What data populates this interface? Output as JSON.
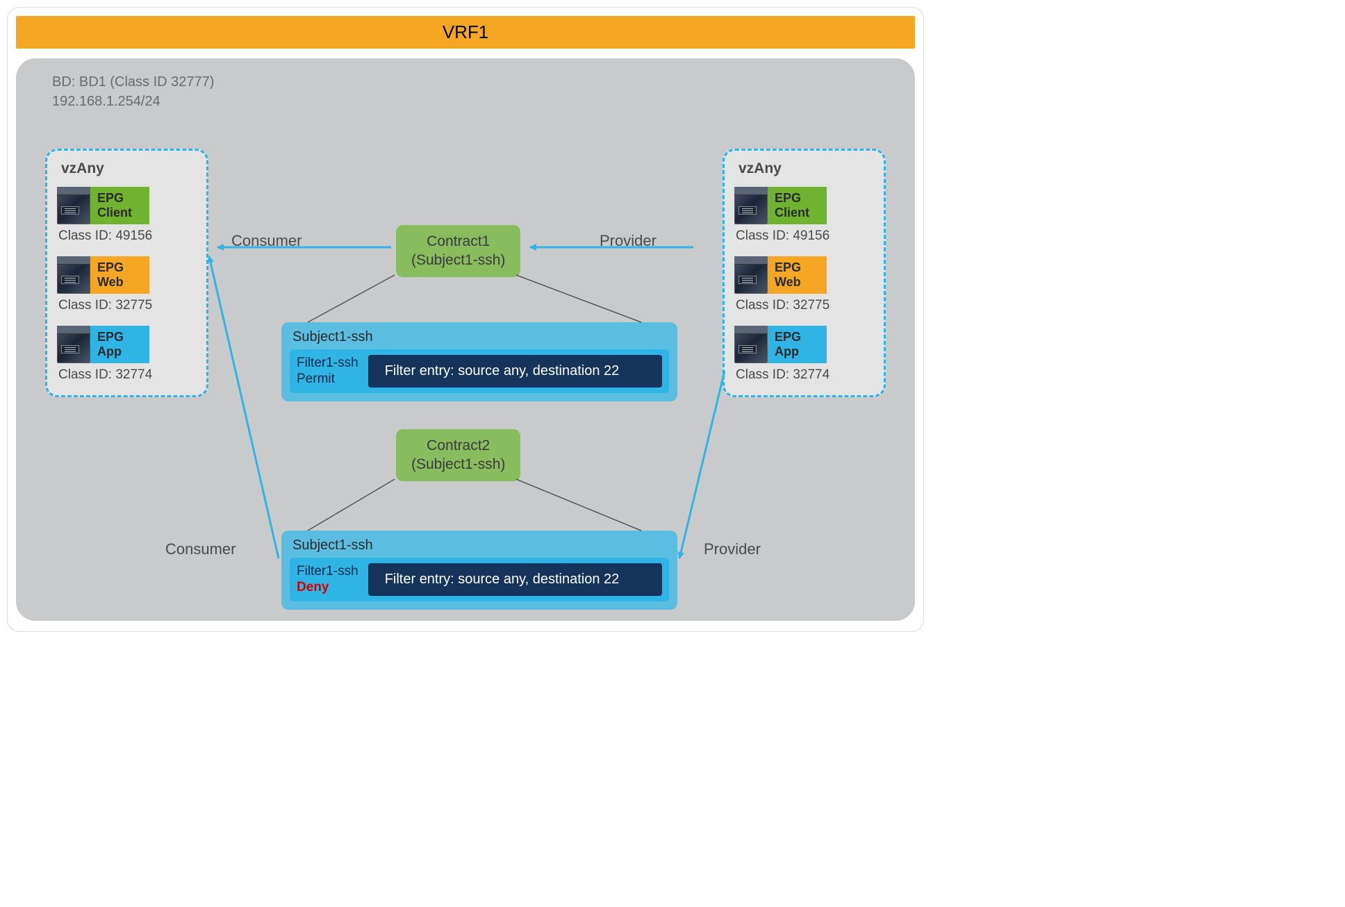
{
  "title": "VRF1",
  "bd": {
    "header_line1": "BD: BD1 (Class ID 32777)",
    "header_line2": "192.168.1.254/24"
  },
  "vzany": {
    "title": "vzAny",
    "epgs": [
      {
        "line1": "EPG",
        "line2": "Client",
        "colorClass": "epg-green",
        "class_id": "Class ID: 49156"
      },
      {
        "line1": "EPG",
        "line2": "Web",
        "colorClass": "epg-orange",
        "class_id": "Class ID: 32775"
      },
      {
        "line1": "EPG",
        "line2": "App",
        "colorClass": "epg-blue",
        "class_id": "Class ID: 32774"
      }
    ]
  },
  "roles": {
    "consumer": "Consumer",
    "provider": "Provider"
  },
  "contract1": {
    "name": "Contract1",
    "subject": "(Subject1-ssh)",
    "subject_box": {
      "title": "Subject1-ssh",
      "filter_name": "Filter1-ssh",
      "action": "Permit",
      "action_deny": false,
      "entry": "Filter entry: source any, destination 22"
    }
  },
  "contract2": {
    "name": "Contract2",
    "subject": "(Subject1-ssh)",
    "subject_box": {
      "title": "Subject1-ssh",
      "filter_name": "Filter1-ssh",
      "action": "Deny",
      "action_deny": true,
      "entry": "Filter entry: source any, destination 22"
    }
  }
}
